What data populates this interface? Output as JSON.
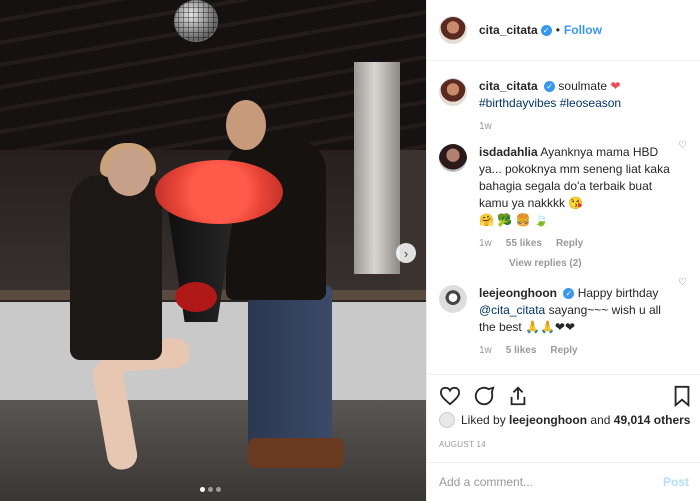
{
  "post": {
    "photo_dots_count": 3,
    "next_icon": "chevron-right-icon"
  },
  "header": {
    "username": "cita_citata",
    "verified_icon": "verified-badge-icon",
    "separator": "•",
    "follow_label": "Follow"
  },
  "caption": {
    "username": "cita_citata",
    "text": "soulmate",
    "emoji": "❤",
    "hashtags": "#birthdayvibes #leoseason",
    "time": "1w"
  },
  "comments": [
    {
      "username": "isdadahlia",
      "text": "Ayanknya mama HBD ya... pokoknya mm seneng liat kaka bahagia segala do'a terbaik buat kamu ya nakkkk",
      "emoji": "😘",
      "emoji_line": "🤗 🥦 🍔 🍃",
      "time": "1w",
      "likes": "55 likes",
      "reply": "Reply",
      "view_replies": "View replies (2)"
    },
    {
      "username": "leejeonghoon",
      "verified": true,
      "text_pre": "Happy birthday",
      "mention": "@cita_citata",
      "text_post": "sayang~~~ wish u all the best",
      "emoji": "🙏🙏❤❤",
      "time": "1w",
      "likes": "5 likes",
      "reply": "Reply"
    }
  ],
  "actions": {
    "like_icon": "heart-outline-icon",
    "comment_icon": "comment-icon",
    "share_icon": "share-icon",
    "save_icon": "bookmark-icon"
  },
  "likes_summary": {
    "prefix": "Liked by",
    "user": "leejeonghoon",
    "middle": "and",
    "count": "49,014 others"
  },
  "date": "AUGUST 14",
  "add_comment": {
    "placeholder": "Add a comment...",
    "post_label": "Post"
  },
  "colors": {
    "accent": "#3897f0",
    "heart": "#ed4956",
    "muted": "#999999",
    "post_disabled": "#b2dffc"
  }
}
